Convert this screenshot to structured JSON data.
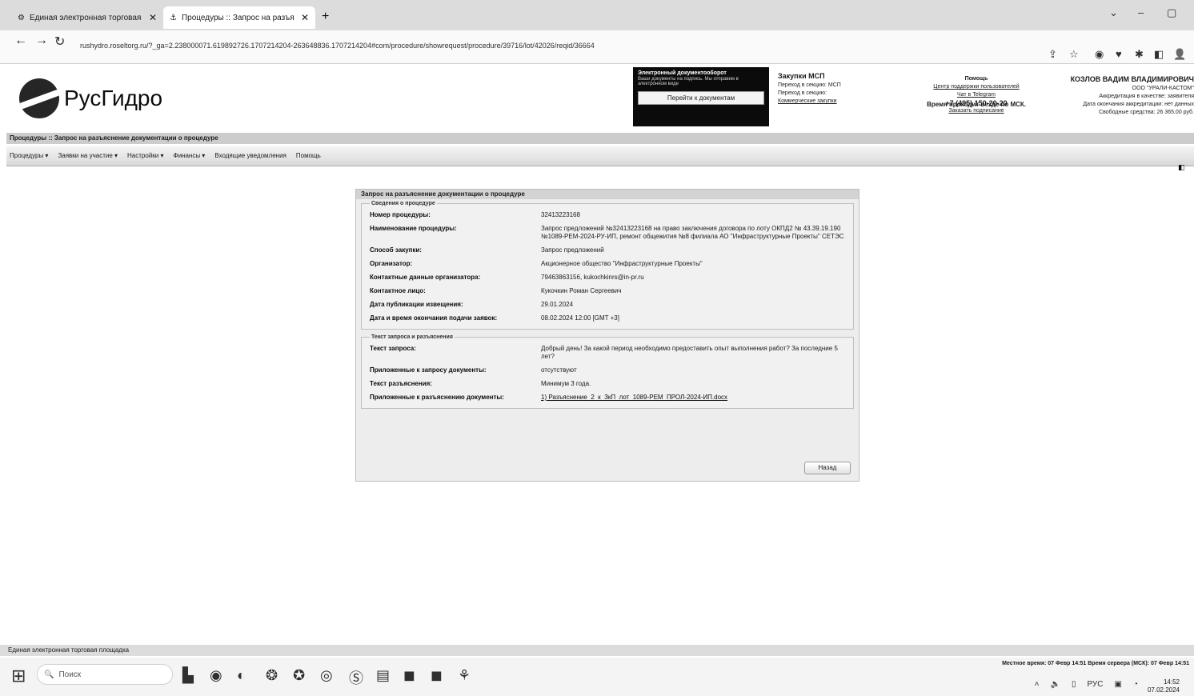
{
  "browser": {
    "tabs": [
      {
        "title": "Единая электронная торговая"
      },
      {
        "title": "Процедуры :: Запрос на разъя"
      }
    ],
    "url": "rushydro.roseltorg.ru/?_ga=2.238000071.619892726.1707214204-263648836.1707214204#com/procedure/showrequest/procedure/39716/lot/42026/reqid/36664"
  },
  "header": {
    "logo_text": "РусГидро",
    "edoc": {
      "title": "Электронный документооборот",
      "subtitle": "Ваши документы на подпись. Мы отправим в электронном виде",
      "button": "Перейти к документам"
    },
    "msp": {
      "title": "Закупки МСП",
      "line1": "Переход в секцию: МСП",
      "line2": "Переход в секцию:",
      "line3": "Коммерческие закупки"
    },
    "help": {
      "title": "Помощь",
      "line1": "Центр поддержки пользователей",
      "line2": "Чат в Telegram",
      "phone": "+7 (495) 150-20-20",
      "line3": "Заказать подписание",
      "clock_note": "Время проходит везде по МСК."
    },
    "user": {
      "name": "КОЗЛОВ ВАДИМ ВЛАДИМИРОВИЧ",
      "org": "ООО \"УРАЛИ-КАСТОМ\"",
      "accr": "Аккредитация в качестве: заявителя",
      "accr_date": "Дата окончания аккредитации: нет данных",
      "funds": "Свободные средства: 26 365.00 руб."
    }
  },
  "breadcrumb": "Процедуры :: Запрос на разъяснение документации о процедуре",
  "menu": [
    "Процедуры ▾",
    "Заявки на участие ▾",
    "Настройки ▾",
    "Финансы ▾",
    "Входящие уведомления",
    "Помощь"
  ],
  "panel": {
    "title": "Запрос на разъяснение документации о процедуре",
    "section1": {
      "legend": "Сведения о процедуре",
      "rows": [
        {
          "label": "Номер процедуры:",
          "value": "32413223168"
        },
        {
          "label": "Наименование процедуры:",
          "value": "Запрос предложений №32413223168 на право заключения договора по лоту ОКПД2 № 43.39.19.190 №1089-РЕМ-2024-РУ-ИП, ремонт общежития №8 филиала АО \"Инфраструктурные Проекты\" СЕТЭС"
        },
        {
          "label": "Способ закупки:",
          "value": "Запрос предложений"
        },
        {
          "label": "Организатор:",
          "value": "Акционерное общество \"Инфраструктурные Проекты\""
        },
        {
          "label": "Контактные данные организатора:",
          "value": "79463863156, kukochkinrs@in-pr.ru"
        },
        {
          "label": "Контактное лицо:",
          "value": "Кукочкин Роман Сергеевич"
        },
        {
          "label": "Дата публикации извещения:",
          "value": "29.01.2024"
        },
        {
          "label": "Дата и время окончания подачи заявок:",
          "value": "08.02.2024 12:00 [GMT +3]"
        }
      ]
    },
    "section2": {
      "legend": "Текст запроса и разъяснения",
      "rows": [
        {
          "label": "Текст запроса:",
          "value": "Добрый день! За какой период необходимо предоставить опыт выполнения работ? За последние 5 лет?"
        },
        {
          "label": "Приложенные к запросу документы:",
          "value": "отсутствуют"
        },
        {
          "label": "Текст разъяснения:",
          "value": "Минимум 3 года."
        },
        {
          "label": "Приложенные к разъяснению документы:",
          "value": "1) Разъяснение_2_к_ЗкП_лот_1089-РЕМ_ПРОЛ-2024-ИП.docx"
        }
      ]
    },
    "back_button": "Назад"
  },
  "statusbar": {
    "left": "Единая электронная торговая площадка",
    "right": "Местное время: 07 Февр 14:51 Время сервера (МСК): 07 Февр 14:51"
  },
  "taskbar": {
    "search_placeholder": "Поиск",
    "lang": "РУС",
    "time": "14:52",
    "date": "07.02.2024"
  }
}
